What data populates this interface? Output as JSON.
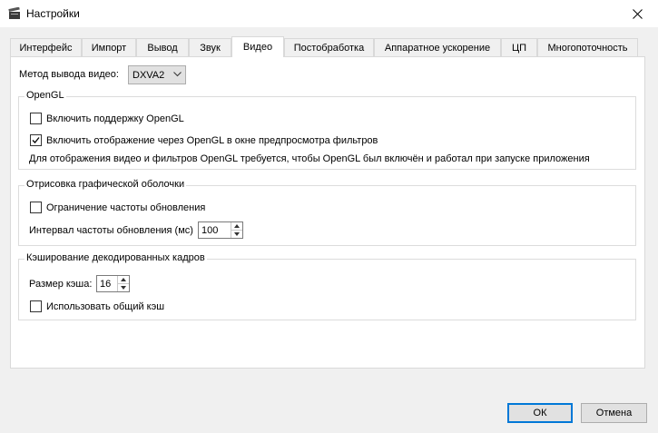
{
  "window": {
    "title": "Настройки"
  },
  "tabs": [
    {
      "label": "Интерфейс"
    },
    {
      "label": "Импорт"
    },
    {
      "label": "Вывод"
    },
    {
      "label": "Звук"
    },
    {
      "label": "Видео",
      "active": true
    },
    {
      "label": "Постобработка"
    },
    {
      "label": "Аппаратное ускорение"
    },
    {
      "label": "ЦП"
    },
    {
      "label": "Многопоточность"
    }
  ],
  "video_output": {
    "label": "Метод вывода видео:",
    "value": "DXVA2"
  },
  "opengl": {
    "title": "OpenGL",
    "enable_support": {
      "label": "Включить поддержку OpenGL",
      "checked": false
    },
    "enable_preview": {
      "label": "Включить отображение через OpenGL в окне предпросмотра фильтров",
      "checked": true
    },
    "note": "Для отображения видео и фильтров OpenGL требуется, чтобы OpenGL был включён и работал при запуске приложения"
  },
  "shell": {
    "title": "Отрисовка графической оболочки",
    "limit_rate": {
      "label": "Ограничение частоты обновления",
      "checked": false
    },
    "interval": {
      "label": "Интервал частоты обновления (мс)",
      "value": "100"
    }
  },
  "cache": {
    "title": "Кэширование декодированных кадров",
    "size": {
      "label": "Размер кэша:",
      "value": "16"
    },
    "shared": {
      "label": "Использовать общий кэш",
      "checked": false
    }
  },
  "buttons": {
    "ok": "ОК",
    "cancel": "Отмена"
  }
}
